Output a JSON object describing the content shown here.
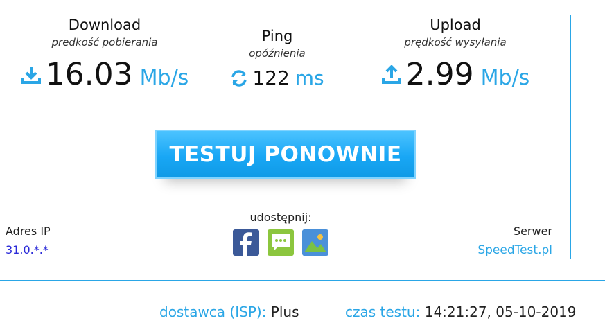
{
  "download": {
    "title": "Download",
    "subtitle": "predkość pobierania",
    "value": "16.03",
    "unit": "Mb/s",
    "icon": "download-icon"
  },
  "ping": {
    "title": "Ping",
    "subtitle": "opóźnienia",
    "value": "122",
    "unit": "ms",
    "icon": "refresh-icon"
  },
  "upload": {
    "title": "Upload",
    "subtitle": "prędkość wysyłania",
    "value": "2.99",
    "unit": "Mb/s",
    "icon": "upload-icon"
  },
  "retest_button": "TESTUJ PONOWNIE",
  "share": {
    "label": "udostępnij:",
    "buttons": [
      "facebook-icon",
      "message-icon",
      "image-icon"
    ]
  },
  "ip": {
    "label": "Adres IP",
    "value": "31.0.*.*"
  },
  "server": {
    "label": "Serwer",
    "value": "SpeedTest.pl"
  },
  "footer": {
    "isp_label": "dostawca (ISP):",
    "isp_value": "Plus",
    "time_label": "czas testu:",
    "time_value": "14:21:27, 05-10-2019"
  },
  "colors": {
    "accent": "#2aa6e6",
    "button": "#19a7f5",
    "ip_link": "#2a2ad8"
  }
}
